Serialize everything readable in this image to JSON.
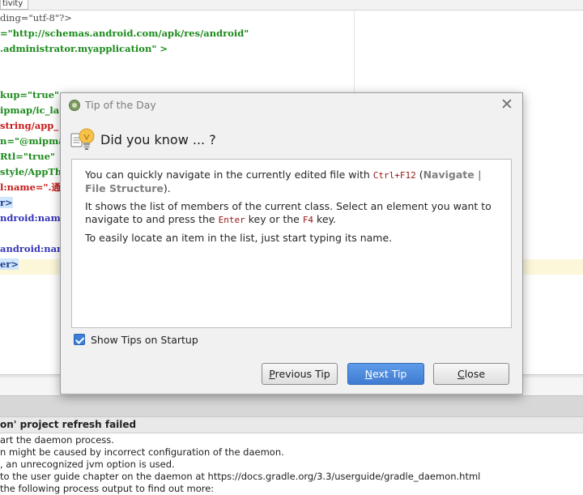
{
  "ide": {
    "tab_label": "tivity",
    "code_lines": [
      {
        "text": "ding=\"utf-8\"?>",
        "cls": "c-dark"
      },
      {
        "text": "=\"http://schemas.android.com/apk/res/android\"",
        "cls": "c-str"
      },
      {
        "text": ".administrator.myapplication\" >",
        "cls": "c-str"
      },
      {
        "text": "",
        "cls": "c-dark"
      },
      {
        "text": "",
        "cls": "c-dark"
      },
      {
        "text": "kup=\"true\"",
        "cls": "c-str"
      },
      {
        "text": "ipmap/ic_la",
        "cls": "c-str"
      },
      {
        "text": "string/app_",
        "cls": "c-red"
      },
      {
        "text": "n=\"@mipmap/",
        "cls": "c-str"
      },
      {
        "text": "Rtl=\"true\"",
        "cls": "c-str"
      },
      {
        "text": "style/AppTh",
        "cls": "c-str"
      },
      {
        "text": "l:name=\".通讯",
        "cls": "c-red"
      },
      {
        "text": "r>",
        "cls": "tag-hl"
      },
      {
        "text": "ndroid:name=",
        "cls": "c-attr"
      },
      {
        "text": "",
        "cls": "c-dark"
      },
      {
        "text": "android:nam",
        "cls": "c-attr"
      },
      {
        "text": "er>",
        "cls": "tag-hl"
      }
    ],
    "messages": {
      "header": "on' project refresh failed",
      "lines": [
        "art the daemon process.",
        "n might be caused by incorrect configuration of the daemon.",
        ", an unrecognized jvm option is used.",
        "to the user guide chapter on the daemon at https://docs.gradle.org/3.3/userguide/gradle_daemon.html",
        "the following process output to find out more:"
      ]
    }
  },
  "dialog": {
    "title": "Tip of the Day",
    "heading": "Did you know ... ?",
    "tip": {
      "p1_before": "You can quickly navigate in the currently edited file with ",
      "p1_key": "Ctrl+F12",
      "p1_mid": " (",
      "p1_menu": "Navigate | File Structure",
      "p1_after": ").",
      "p2_before": "It shows the list of members of the current class. Select an element you want to navigate to and press the ",
      "p2_key1": "Enter",
      "p2_mid": " key or the ",
      "p2_key2": "F4",
      "p2_after": " key.",
      "p3": "To easily locate an item in the list, just start typing its name."
    },
    "show_tips": {
      "label": "Show Tips on Startup",
      "checked": true
    },
    "buttons": {
      "previous": {
        "mnemonic": "P",
        "rest": "revious Tip"
      },
      "next": {
        "mnemonic": "N",
        "rest": "ext Tip"
      },
      "close": {
        "mnemonic": "C",
        "rest": "lose"
      }
    }
  },
  "icons": [
    "android-studio-icon",
    "close-icon",
    "lightbulb-icon",
    "checkbox-checked-icon"
  ],
  "colors": {
    "primary_button": "#4a8ae0",
    "checkbox": "#3d7fd6",
    "keystroke": "#931717",
    "menu_path": "#808080"
  }
}
